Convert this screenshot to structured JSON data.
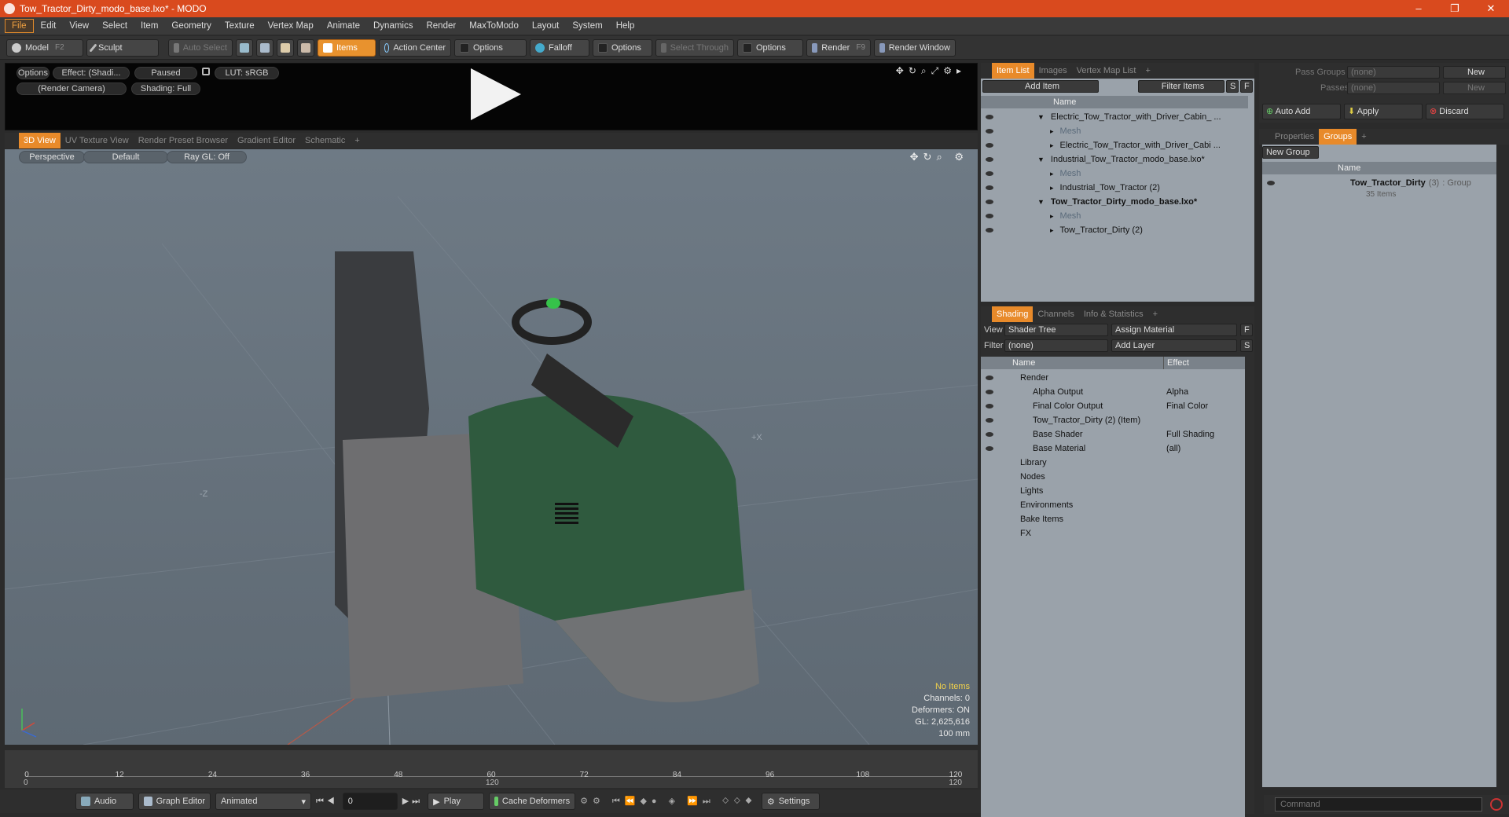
{
  "window": {
    "title": "Tow_Tractor_Dirty_modo_base.lxo* - MODO",
    "controls": [
      "–",
      "❐",
      "✕"
    ]
  },
  "menu": [
    "File",
    "Edit",
    "View",
    "Select",
    "Item",
    "Geometry",
    "Texture",
    "Vertex Map",
    "Animate",
    "Dynamics",
    "Render",
    "MaxToModo",
    "Layout",
    "System",
    "Help"
  ],
  "toolbar": {
    "model": "Model",
    "model_key": "F2",
    "sculpt": "Sculpt",
    "auto_select": "Auto Select",
    "items": "Items",
    "action_center": "Action Center",
    "options1": "Options",
    "falloff": "Falloff",
    "options2": "Options",
    "select_through": "Select Through",
    "options3": "Options",
    "render": "Render",
    "render_key": "F9",
    "render_window": "Render Window"
  },
  "preview": {
    "options": "Options",
    "effect": "Effect: (Shadi...",
    "paused": "Paused",
    "lut": "LUT: sRGB",
    "camera": "(Render Camera)",
    "shading": "Shading: Full"
  },
  "viewport_tabs": [
    "3D View",
    "UV Texture View",
    "Render Preset Browser",
    "Gradient Editor",
    "Schematic",
    "+"
  ],
  "viewport": {
    "perspective": "Perspective",
    "default": "Default",
    "raygl": "Ray GL: Off",
    "axis_x": "+X",
    "axis_z": "-Z",
    "stats": [
      "No Items",
      "Channels: 0",
      "Deformers: ON",
      "GL: 2,625,616",
      "100 mm"
    ]
  },
  "timeline": {
    "ticks": [
      "0",
      "12",
      "24",
      "36",
      "48",
      "60",
      "72",
      "84",
      "96",
      "108",
      "120"
    ],
    "sub_left": "0",
    "sub_mid": "120",
    "sub_right": "120"
  },
  "bottombar": {
    "audio": "Audio",
    "graph_editor": "Graph Editor",
    "animated": "Animated",
    "frame": "0",
    "play": "Play",
    "cache": "Cache Deformers",
    "settings": "Settings"
  },
  "itemlist": {
    "tabs": [
      "Item List",
      "Images",
      "Vertex Map List",
      "+"
    ],
    "add_item": "Add Item",
    "filter_items": "Filter Items",
    "s": "S",
    "f": "F",
    "col_name": "Name",
    "rows": [
      {
        "label": "Electric_Tow_Tractor_with_Driver_Cabin_ ...",
        "indent": 0,
        "bold": false,
        "grey": false
      },
      {
        "label": "Mesh",
        "indent": 1,
        "bold": false,
        "grey": true
      },
      {
        "label": "Electric_Tow_Tractor_with_Driver_Cabi ...",
        "indent": 1,
        "bold": false,
        "grey": false
      },
      {
        "label": "Industrial_Tow_Tractor_modo_base.lxo*",
        "indent": 0,
        "bold": false,
        "grey": false
      },
      {
        "label": "Mesh",
        "indent": 1,
        "bold": false,
        "grey": true
      },
      {
        "label": "Industrial_Tow_Tractor (2)",
        "indent": 1,
        "bold": false,
        "grey": false
      },
      {
        "label": "Tow_Tractor_Dirty_modo_base.lxo*",
        "indent": 0,
        "bold": true,
        "grey": false
      },
      {
        "label": "Mesh",
        "indent": 1,
        "bold": false,
        "grey": true
      },
      {
        "label": "Tow_Tractor_Dirty (2)",
        "indent": 1,
        "bold": false,
        "grey": false
      }
    ]
  },
  "shading": {
    "tabs": [
      "Shading",
      "Channels",
      "Info & Statistics",
      "+"
    ],
    "view_label": "View",
    "view_value": "Shader Tree",
    "assign_material": "Assign Material",
    "f": "F",
    "filter_label": "Filter",
    "filter_value": "(none)",
    "add_layer": "Add Layer",
    "s": "S",
    "col_name": "Name",
    "col_effect": "Effect",
    "rows": [
      {
        "label": "Render",
        "effect": "",
        "indent": 0
      },
      {
        "label": "Alpha Output",
        "effect": "Alpha",
        "indent": 1
      },
      {
        "label": "Final Color Output",
        "effect": "Final Color",
        "indent": 1
      },
      {
        "label": "Tow_Tractor_Dirty (2) (Item)",
        "effect": "",
        "indent": 1
      },
      {
        "label": "Base Shader",
        "effect": "Full Shading",
        "indent": 1
      },
      {
        "label": "Base Material",
        "effect": "(all)",
        "indent": 1
      },
      {
        "label": "Library",
        "effect": "",
        "indent": 0
      },
      {
        "label": "Nodes",
        "effect": "",
        "indent": 0
      },
      {
        "label": "Lights",
        "effect": "",
        "indent": 0
      },
      {
        "label": "Environments",
        "effect": "",
        "indent": 0
      },
      {
        "label": "Bake Items",
        "effect": "",
        "indent": 0
      },
      {
        "label": "FX",
        "effect": "",
        "indent": 0
      }
    ]
  },
  "passes": {
    "pass_groups": "Pass Groups",
    "pass_groups_value": "(none)",
    "new": "New",
    "passes": "Passes",
    "passes_value": "(none)",
    "new2": "New",
    "auto_add": "Auto Add",
    "apply": "Apply",
    "discard": "Discard"
  },
  "groups": {
    "tabs": [
      "Properties",
      "Groups",
      "+"
    ],
    "new_group": "New Group",
    "col_name": "Name",
    "group_name": "Tow_Tractor_Dirty",
    "group_count": "(3)",
    "group_type": ": Group",
    "group_items": "35 Items"
  },
  "command": {
    "placeholder": "Command"
  }
}
